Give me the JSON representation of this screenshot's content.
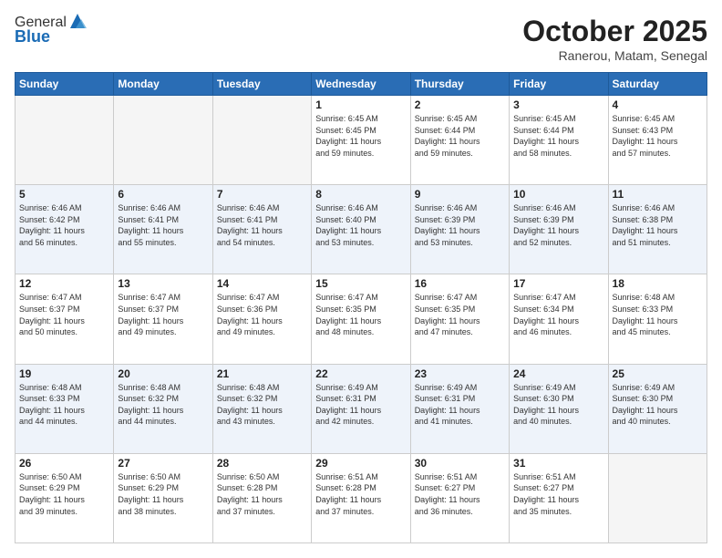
{
  "logo": {
    "general": "General",
    "blue": "Blue"
  },
  "header": {
    "month": "October 2025",
    "location": "Ranerou, Matam, Senegal"
  },
  "weekdays": [
    "Sunday",
    "Monday",
    "Tuesday",
    "Wednesday",
    "Thursday",
    "Friday",
    "Saturday"
  ],
  "weeks": [
    [
      {
        "day": "",
        "info": ""
      },
      {
        "day": "",
        "info": ""
      },
      {
        "day": "",
        "info": ""
      },
      {
        "day": "1",
        "info": "Sunrise: 6:45 AM\nSunset: 6:45 PM\nDaylight: 11 hours\nand 59 minutes."
      },
      {
        "day": "2",
        "info": "Sunrise: 6:45 AM\nSunset: 6:44 PM\nDaylight: 11 hours\nand 59 minutes."
      },
      {
        "day": "3",
        "info": "Sunrise: 6:45 AM\nSunset: 6:44 PM\nDaylight: 11 hours\nand 58 minutes."
      },
      {
        "day": "4",
        "info": "Sunrise: 6:45 AM\nSunset: 6:43 PM\nDaylight: 11 hours\nand 57 minutes."
      }
    ],
    [
      {
        "day": "5",
        "info": "Sunrise: 6:46 AM\nSunset: 6:42 PM\nDaylight: 11 hours\nand 56 minutes."
      },
      {
        "day": "6",
        "info": "Sunrise: 6:46 AM\nSunset: 6:41 PM\nDaylight: 11 hours\nand 55 minutes."
      },
      {
        "day": "7",
        "info": "Sunrise: 6:46 AM\nSunset: 6:41 PM\nDaylight: 11 hours\nand 54 minutes."
      },
      {
        "day": "8",
        "info": "Sunrise: 6:46 AM\nSunset: 6:40 PM\nDaylight: 11 hours\nand 53 minutes."
      },
      {
        "day": "9",
        "info": "Sunrise: 6:46 AM\nSunset: 6:39 PM\nDaylight: 11 hours\nand 53 minutes."
      },
      {
        "day": "10",
        "info": "Sunrise: 6:46 AM\nSunset: 6:39 PM\nDaylight: 11 hours\nand 52 minutes."
      },
      {
        "day": "11",
        "info": "Sunrise: 6:46 AM\nSunset: 6:38 PM\nDaylight: 11 hours\nand 51 minutes."
      }
    ],
    [
      {
        "day": "12",
        "info": "Sunrise: 6:47 AM\nSunset: 6:37 PM\nDaylight: 11 hours\nand 50 minutes."
      },
      {
        "day": "13",
        "info": "Sunrise: 6:47 AM\nSunset: 6:37 PM\nDaylight: 11 hours\nand 49 minutes."
      },
      {
        "day": "14",
        "info": "Sunrise: 6:47 AM\nSunset: 6:36 PM\nDaylight: 11 hours\nand 49 minutes."
      },
      {
        "day": "15",
        "info": "Sunrise: 6:47 AM\nSunset: 6:35 PM\nDaylight: 11 hours\nand 48 minutes."
      },
      {
        "day": "16",
        "info": "Sunrise: 6:47 AM\nSunset: 6:35 PM\nDaylight: 11 hours\nand 47 minutes."
      },
      {
        "day": "17",
        "info": "Sunrise: 6:47 AM\nSunset: 6:34 PM\nDaylight: 11 hours\nand 46 minutes."
      },
      {
        "day": "18",
        "info": "Sunrise: 6:48 AM\nSunset: 6:33 PM\nDaylight: 11 hours\nand 45 minutes."
      }
    ],
    [
      {
        "day": "19",
        "info": "Sunrise: 6:48 AM\nSunset: 6:33 PM\nDaylight: 11 hours\nand 44 minutes."
      },
      {
        "day": "20",
        "info": "Sunrise: 6:48 AM\nSunset: 6:32 PM\nDaylight: 11 hours\nand 44 minutes."
      },
      {
        "day": "21",
        "info": "Sunrise: 6:48 AM\nSunset: 6:32 PM\nDaylight: 11 hours\nand 43 minutes."
      },
      {
        "day": "22",
        "info": "Sunrise: 6:49 AM\nSunset: 6:31 PM\nDaylight: 11 hours\nand 42 minutes."
      },
      {
        "day": "23",
        "info": "Sunrise: 6:49 AM\nSunset: 6:31 PM\nDaylight: 11 hours\nand 41 minutes."
      },
      {
        "day": "24",
        "info": "Sunrise: 6:49 AM\nSunset: 6:30 PM\nDaylight: 11 hours\nand 40 minutes."
      },
      {
        "day": "25",
        "info": "Sunrise: 6:49 AM\nSunset: 6:30 PM\nDaylight: 11 hours\nand 40 minutes."
      }
    ],
    [
      {
        "day": "26",
        "info": "Sunrise: 6:50 AM\nSunset: 6:29 PM\nDaylight: 11 hours\nand 39 minutes."
      },
      {
        "day": "27",
        "info": "Sunrise: 6:50 AM\nSunset: 6:29 PM\nDaylight: 11 hours\nand 38 minutes."
      },
      {
        "day": "28",
        "info": "Sunrise: 6:50 AM\nSunset: 6:28 PM\nDaylight: 11 hours\nand 37 minutes."
      },
      {
        "day": "29",
        "info": "Sunrise: 6:51 AM\nSunset: 6:28 PM\nDaylight: 11 hours\nand 37 minutes."
      },
      {
        "day": "30",
        "info": "Sunrise: 6:51 AM\nSunset: 6:27 PM\nDaylight: 11 hours\nand 36 minutes."
      },
      {
        "day": "31",
        "info": "Sunrise: 6:51 AM\nSunset: 6:27 PM\nDaylight: 11 hours\nand 35 minutes."
      },
      {
        "day": "",
        "info": ""
      }
    ]
  ]
}
